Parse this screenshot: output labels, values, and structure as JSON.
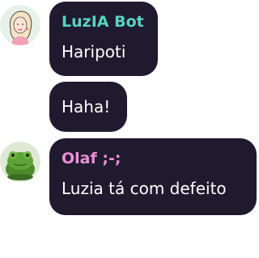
{
  "messages": [
    {
      "sender": "LuzIA Bot",
      "sender_color": "#57d4c0",
      "avatar_icon": "luzia-bot-avatar-icon",
      "texts": [
        "Haripoti",
        "Haha!"
      ]
    },
    {
      "sender": "Olaf ;-;",
      "sender_color": "#f08fd8",
      "avatar_icon": "frog-avatar-icon",
      "texts": [
        "Luzia tá com defeito"
      ]
    }
  ],
  "colors": {
    "bubble_bg": "#1f1a2e",
    "page_bg": "#ffffff"
  }
}
